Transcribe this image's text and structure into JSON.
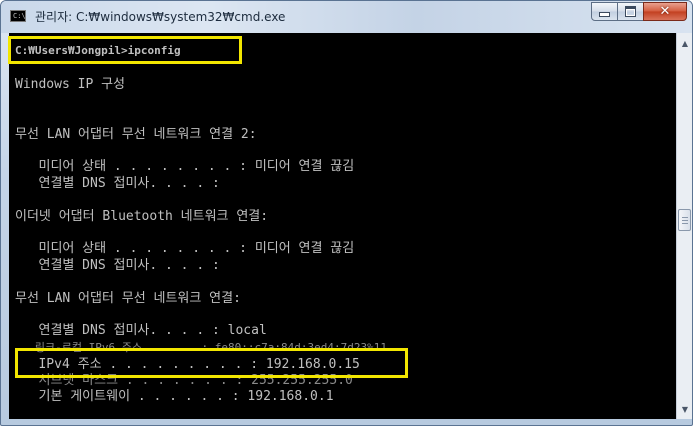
{
  "window": {
    "title": "관리자: C:₩windows₩system32₩cmd.exe",
    "icon_text": "C:\\",
    "minimize_icon": "minimize-icon",
    "maximize_icon": "maximize-icon",
    "close_glyph": "✕"
  },
  "console": {
    "lines": [
      "C:₩Users₩Jongpil>ipconfig",
      "Windows IP 구성",
      "무선 LAN 어댑터 무선 네트워크 연결 2:",
      "   미디어 상태 . . . . . . . . : 미디어 연결 끊김",
      "   연결별 DNS 접미사. . . . :",
      "이더넷 어댑터 Bluetooth 네트워크 연결:",
      "   미디어 상태 . . . . . . . . : 미디어 연결 끊김",
      "   연결별 DNS 접미사. . . . :",
      "무선 LAN 어댑터 무선 네트워크 연결:",
      "   연결별 DNS 접미사. . . . : local",
      "   링크-로컬 IPv6 주소 . . . . : fe80::c7a:84d:3ed4:7d23%11",
      "   IPv4 주소 . . . . . . . . . : 192.168.0.15",
      "   서브넷 마스크 . . . . . . . : 255.255.255.0",
      "   기본 게이트웨이 . . . . . . : 192.168.0.1"
    ]
  },
  "highlight_color": "#f2e600",
  "scrollbar": {
    "up_arrow": "▲",
    "down_arrow": "▼"
  }
}
